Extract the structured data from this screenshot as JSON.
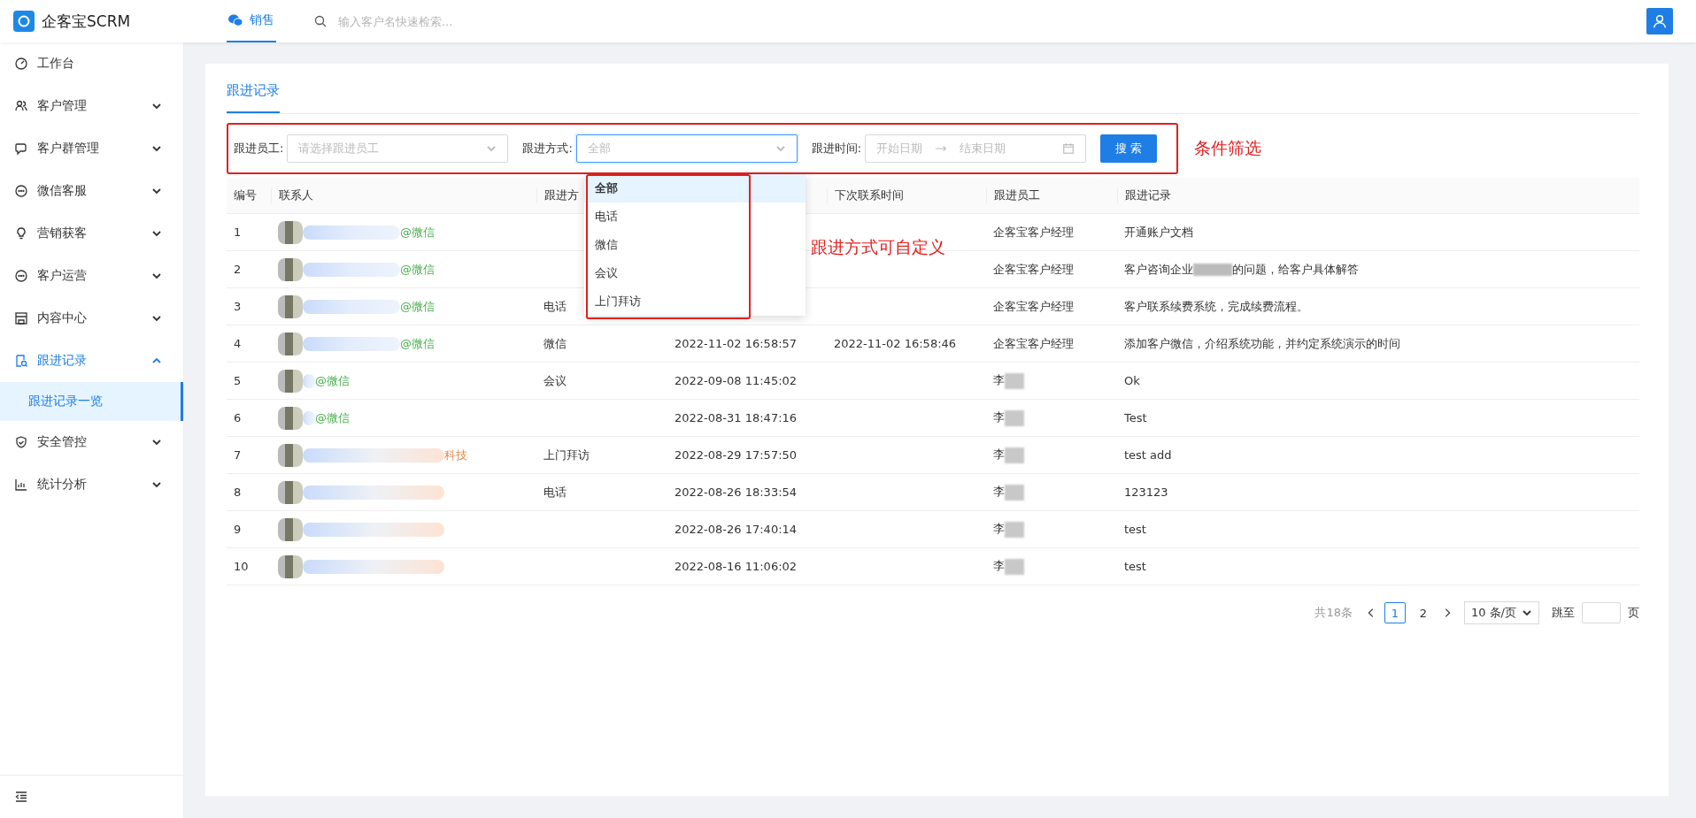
{
  "app": {
    "title": "企客宝SCRM"
  },
  "top_nav": {
    "tabs": [
      {
        "label": "销售",
        "selected": true
      }
    ],
    "search": {
      "placeholder": "输入客户名快速检索..."
    }
  },
  "sidebar": {
    "items": [
      {
        "label": "工作台",
        "selected": false
      },
      {
        "label": "客户管理",
        "selected": false,
        "expanded": false
      },
      {
        "label": "客户群管理",
        "selected": false,
        "expanded": false
      },
      {
        "label": "微信客服",
        "selected": false,
        "expanded": false
      },
      {
        "label": "营销获客",
        "selected": false,
        "expanded": false
      },
      {
        "label": "客户运营",
        "selected": false,
        "expanded": false
      },
      {
        "label": "内容中心",
        "selected": false,
        "expanded": false
      },
      {
        "label": "跟进记录",
        "selected": false,
        "expanded": true,
        "children": [
          {
            "label": "跟进记录一览",
            "selected": true
          }
        ]
      },
      {
        "label": "安全管控",
        "selected": false,
        "expanded": false
      },
      {
        "label": "统计分析",
        "selected": false,
        "expanded": false
      }
    ]
  },
  "page_tabs": [
    {
      "label": "跟进记录",
      "selected": true
    }
  ],
  "filters": {
    "employee": {
      "label": "跟进员工:",
      "placeholder": "请选择跟进员工"
    },
    "method": {
      "label": "跟进方式:",
      "value": "全部",
      "open": true,
      "options": [
        {
          "label": "全部",
          "selected": true
        },
        {
          "label": "电话",
          "selected": false
        },
        {
          "label": "微信",
          "selected": false
        },
        {
          "label": "会议",
          "selected": false
        },
        {
          "label": "上门拜访",
          "selected": false
        }
      ]
    },
    "time": {
      "label": "跟进时间:",
      "start_placeholder": "开始日期",
      "end_placeholder": "结束日期"
    },
    "search_button": "搜 索"
  },
  "annotations": [
    {
      "text": "条件筛选"
    },
    {
      "text": "跟进方式可自定义"
    }
  ],
  "table": {
    "columns": [
      "编号",
      "联系人",
      "跟进方",
      "",
      "下次联系时间",
      "跟进员工",
      "跟进记录"
    ],
    "rows": [
      {
        "no": "1",
        "contact": {
          "kind": "wechat",
          "suffix": "@微信"
        },
        "method": "",
        "time": "",
        "next_time": "",
        "employee": {
          "text": "企客宝客户经理",
          "blurred": false
        },
        "record": [
          "开通账户文档"
        ]
      },
      {
        "no": "2",
        "contact": {
          "kind": "wechat",
          "suffix": "@微信"
        },
        "method": "",
        "time": "",
        "next_time": "",
        "employee": {
          "text": "企客宝客户经理",
          "blurred": false
        },
        "record": [
          "客户咨询企业",
          "的问题，给客户具体解答"
        ]
      },
      {
        "no": "3",
        "contact": {
          "kind": "wechat",
          "suffix": "@微信"
        },
        "method": "电话",
        "time": "",
        "next_time": "",
        "employee": {
          "text": "企客宝客户经理",
          "blurred": false
        },
        "record": [
          "客户联系续费系统，完成续费流程。"
        ]
      },
      {
        "no": "4",
        "contact": {
          "kind": "wechat",
          "suffix": "@微信"
        },
        "method": "微信",
        "time": "2022-11-02 16:58:57",
        "next_time": "2022-11-02 16:58:46",
        "employee": {
          "text": "企客宝客户经理",
          "blurred": false
        },
        "record": [
          "添加客户微信，介绍系统功能，并约定系统演示的时间"
        ]
      },
      {
        "no": "5",
        "contact": {
          "kind": "wechat",
          "suffix": "@微信"
        },
        "method": "会议",
        "time": "2022-09-08 11:45:02",
        "next_time": "",
        "employee": {
          "text": "李",
          "blurred": true
        },
        "record": [
          "Ok"
        ]
      },
      {
        "no": "6",
        "contact": {
          "kind": "wechat",
          "suffix": "@微信"
        },
        "method": "",
        "time": "2022-08-31 18:47:16",
        "next_time": "",
        "employee": {
          "text": "李",
          "blurred": true
        },
        "record": [
          "Test"
        ]
      },
      {
        "no": "7",
        "contact": {
          "kind": "company",
          "suffix": "科技"
        },
        "method": "上门拜访",
        "time": "2022-08-29 17:57:50",
        "next_time": "",
        "employee": {
          "text": "李",
          "blurred": true
        },
        "record": [
          "test add"
        ]
      },
      {
        "no": "8",
        "contact": {
          "kind": "company"
        },
        "method": "电话",
        "time": "2022-08-26 18:33:54",
        "next_time": "",
        "employee": {
          "text": "李",
          "blurred": true
        },
        "record": [
          "123123"
        ]
      },
      {
        "no": "9",
        "contact": {
          "kind": "company"
        },
        "method": "",
        "time": "2022-08-26 17:40:14",
        "next_time": "",
        "employee": {
          "text": "李",
          "blurred": true
        },
        "record": [
          "test"
        ]
      },
      {
        "no": "10",
        "contact": {
          "kind": "company"
        },
        "method": "",
        "time": "2022-08-16 11:06:02",
        "next_time": "",
        "employee": {
          "text": "李",
          "blurred": true
        },
        "record": [
          "test"
        ]
      }
    ]
  },
  "pagination": {
    "total": "共18条",
    "pages": [
      {
        "label": "1",
        "selected": true
      },
      {
        "label": "2",
        "selected": false
      }
    ],
    "page_size": "10 条/页",
    "jump_label": "跳至",
    "jump_suffix": "页"
  }
}
